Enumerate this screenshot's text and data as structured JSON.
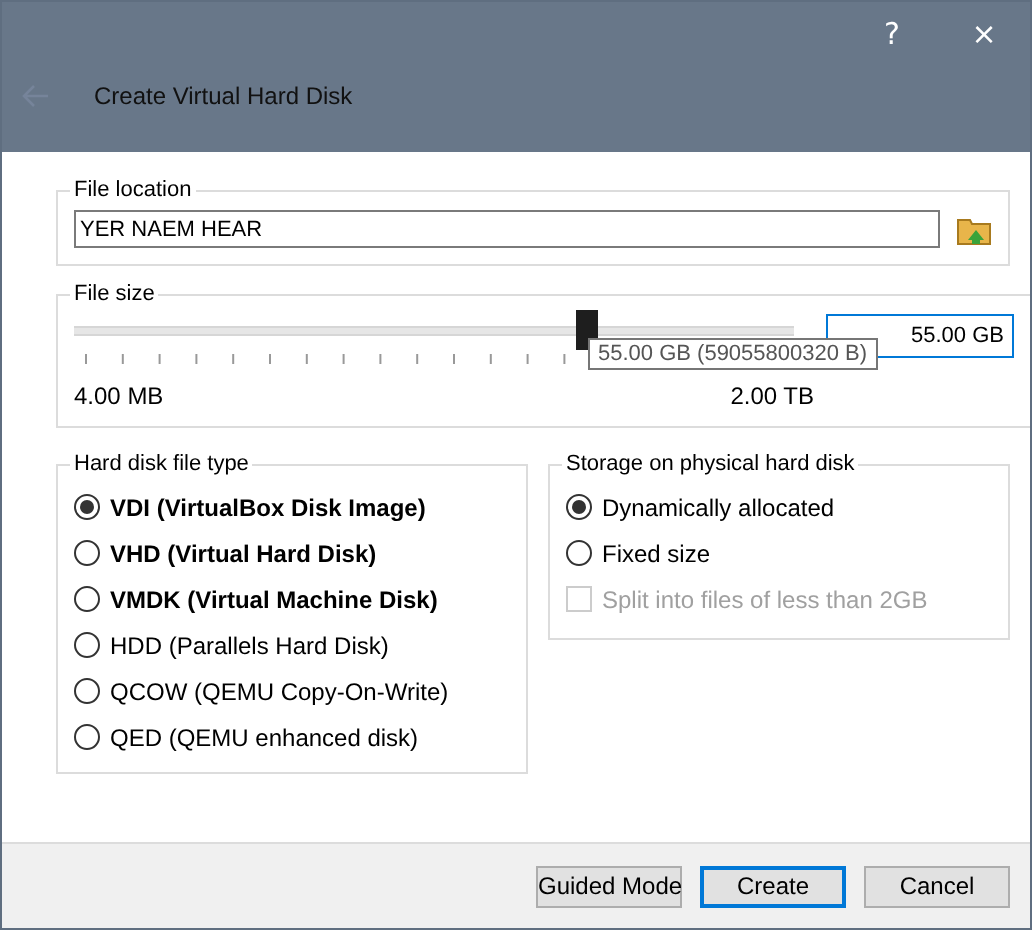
{
  "window": {
    "title": "Create Virtual Hard Disk",
    "help": "?",
    "close": "×"
  },
  "file_location": {
    "label": "File location",
    "value": "YER NAEM HEAR"
  },
  "file_size": {
    "label": "File size",
    "level": 0.71,
    "value": "55.00 GB",
    "min_label": "4.00 MB",
    "max_label": "2.00 TB",
    "tooltip": "55.00 GB (59055800320 B)"
  },
  "file_type": {
    "label": "Hard disk file type",
    "options": [
      {
        "label": "VDI (VirtualBox Disk Image)",
        "selected": true,
        "bold": true
      },
      {
        "label": "VHD (Virtual Hard Disk)",
        "selected": false,
        "bold": true
      },
      {
        "label": "VMDK (Virtual Machine Disk)",
        "selected": false,
        "bold": true
      },
      {
        "label": "HDD (Parallels Hard Disk)",
        "selected": false,
        "bold": false
      },
      {
        "label": "QCOW (QEMU Copy-On-Write)",
        "selected": false,
        "bold": false
      },
      {
        "label": "QED (QEMU enhanced disk)",
        "selected": false,
        "bold": false
      }
    ]
  },
  "storage": {
    "label": "Storage on physical hard disk",
    "options": [
      {
        "label": "Dynamically allocated",
        "selected": true
      },
      {
        "label": "Fixed size",
        "selected": false
      }
    ],
    "split": {
      "label": "Split into files of less than 2GB",
      "checked": false,
      "disabled": true
    }
  },
  "buttons": [
    {
      "label": "Guided Mode",
      "default": false
    },
    {
      "label": "Create",
      "default": true
    },
    {
      "label": "Cancel",
      "default": false
    }
  ]
}
